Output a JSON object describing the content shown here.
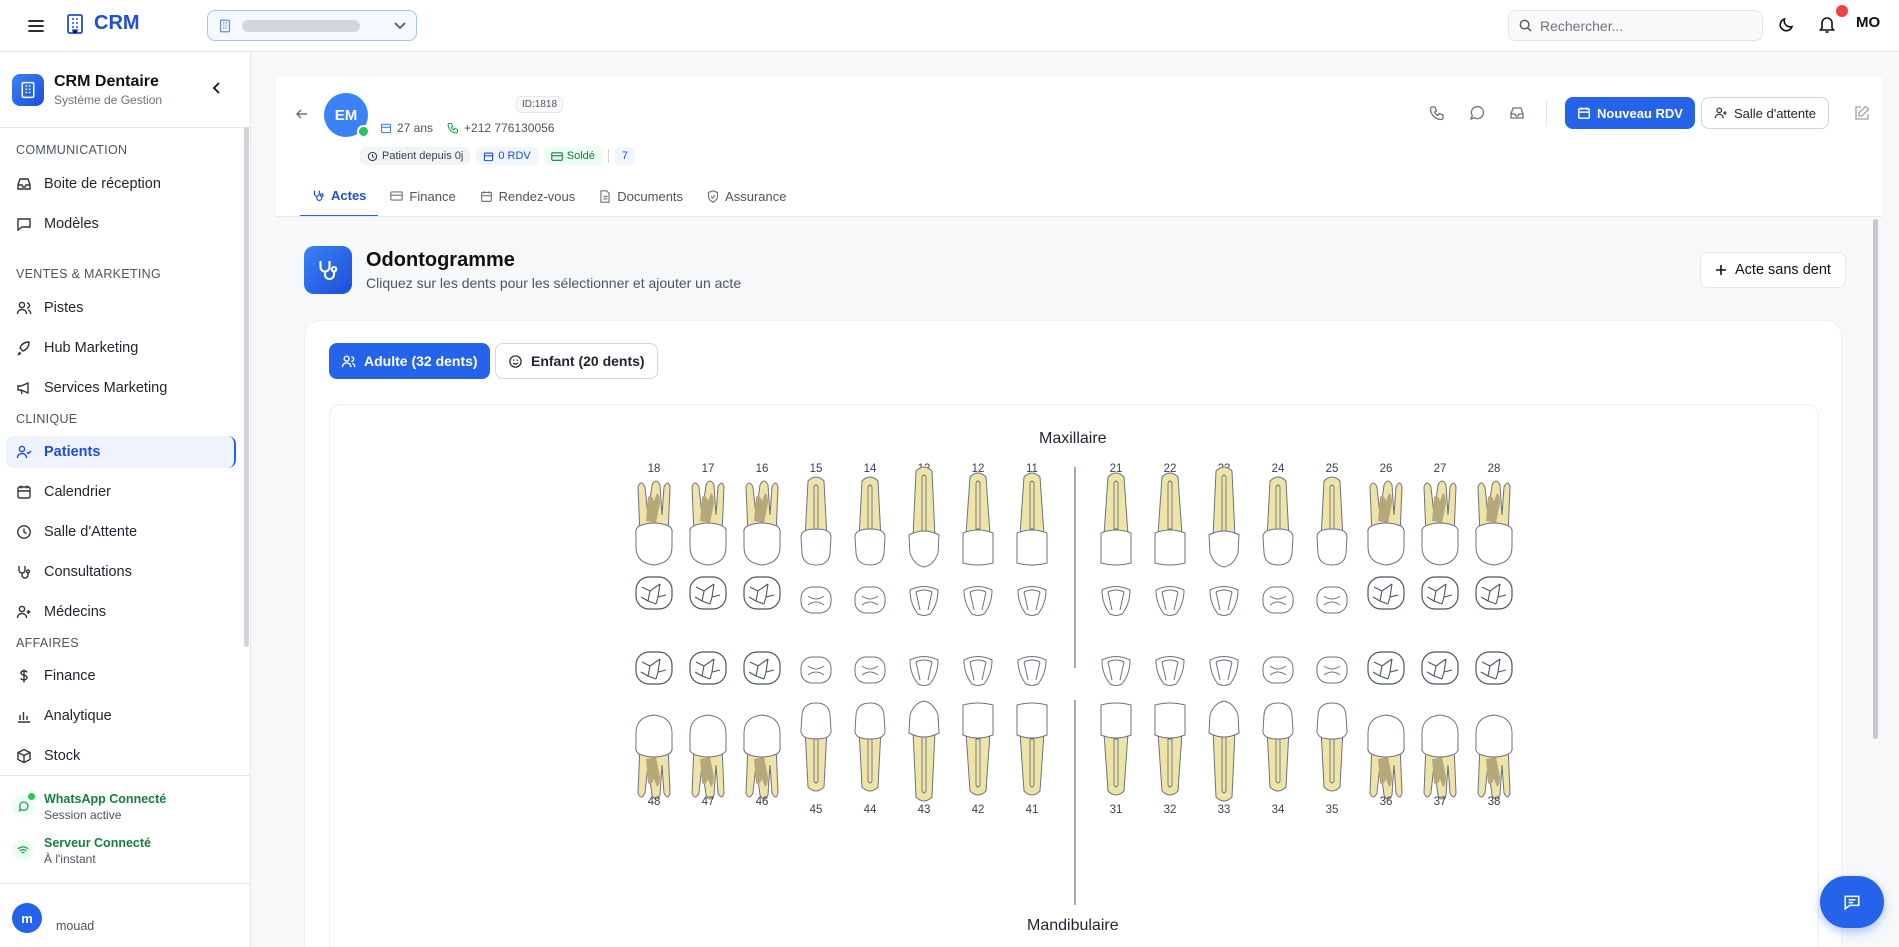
{
  "app": {
    "name": "CRM"
  },
  "search": {
    "placeholder": "Rechercher..."
  },
  "user": {
    "initials": "MO",
    "sidebar_initial": "m",
    "name": "mouad"
  },
  "sidebar": {
    "title": "CRM Dentaire",
    "subtitle": "Système de Gestion",
    "sections": {
      "communication": "COMMUNICATION",
      "ventes": "VENTES & MARKETING",
      "clinique": "CLINIQUE",
      "affaires": "AFFAIRES"
    },
    "items": {
      "inbox": "Boite de réception",
      "models": "Modèles",
      "pistes": "Pistes",
      "hub": "Hub Marketing",
      "services": "Services Marketing",
      "patients": "Patients",
      "calendar": "Calendrier",
      "waiting": "Salle d'Attente",
      "consult": "Consultations",
      "doctors": "Médecins",
      "finance": "Finance",
      "analytics": "Analytique",
      "stock": "Stock"
    },
    "status": {
      "whatsapp_title": "WhatsApp Connecté",
      "whatsapp_sub": "Session active",
      "server_title": "Serveur Connecté",
      "server_sub": "À l'instant"
    }
  },
  "patient": {
    "initials": "EM",
    "id": "ID:1818",
    "age": "27 ans",
    "phone": "+212 776130056",
    "since": "Patient depuis 0j",
    "rdv": "0 RDV",
    "balance": "Soldé",
    "count": "7"
  },
  "actions": {
    "new_rdv": "Nouveau RDV",
    "waiting_room": "Salle d'attente"
  },
  "tabs": [
    "Actes",
    "Finance",
    "Rendez-vous",
    "Documents",
    "Assurance"
  ],
  "odontogram": {
    "title": "Odontogramme",
    "subtitle": "Cliquez sur les dents pour les sélectionner et ajouter un acte",
    "acte_button": "Acte sans dent",
    "adult_toggle": "Adulte (32 dents)",
    "child_toggle": "Enfant (20 dents)",
    "upper_label": "Maxillaire",
    "lower_label": "Mandibulaire",
    "upper_teeth": [
      "18",
      "17",
      "16",
      "15",
      "14",
      "13",
      "12",
      "11",
      "21",
      "22",
      "23",
      "24",
      "25",
      "26",
      "27",
      "28"
    ],
    "lower_teeth": [
      "48",
      "47",
      "46",
      "45",
      "44",
      "43",
      "42",
      "41",
      "31",
      "32",
      "33",
      "34",
      "35",
      "36",
      "37",
      "38"
    ]
  },
  "colors": {
    "accent": "#2563eb",
    "tooth_root": "#efe4a8",
    "pulp": "#b5a97c",
    "success": "#16a34a"
  }
}
